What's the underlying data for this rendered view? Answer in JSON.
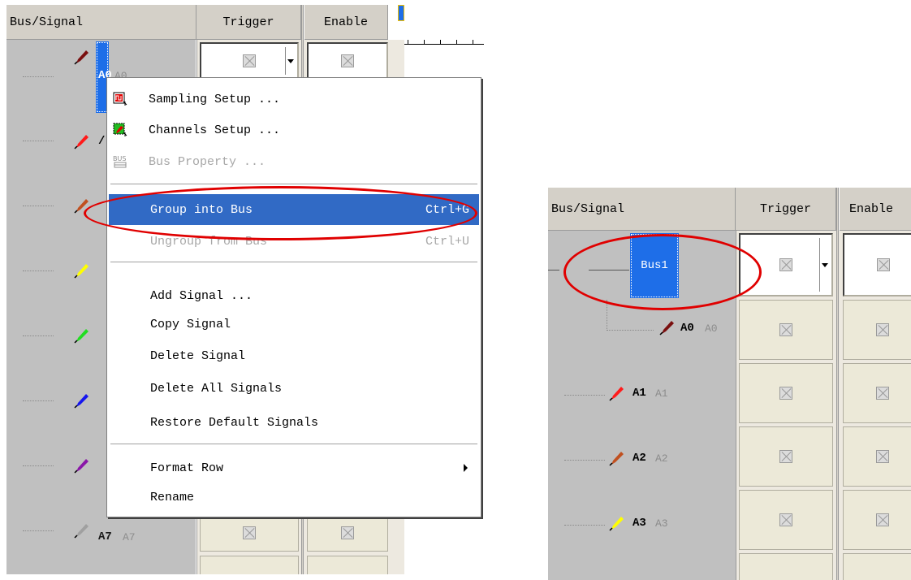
{
  "left_panel": {
    "header": {
      "signal_col": "Bus/Signal",
      "trigger_col": "Trigger",
      "enable_col": "Enable"
    },
    "selected_signal": {
      "label": "A0",
      "alias": "A0"
    },
    "last_signal": {
      "label": "A7",
      "alias": "A7",
      "color": "#a0a0a0"
    },
    "probe_colors": [
      "#7a0f0f",
      "#ff1a1a",
      "#c05020",
      "#ffff00",
      "#22dd22",
      "#1616ee",
      "#8a17a8",
      "#a0a0a0"
    ]
  },
  "context_menu": {
    "items": [
      {
        "label": "Sampling Setup ...",
        "icon": "sampling-setup-icon"
      },
      {
        "label": "Channels Setup ...",
        "icon": "channels-setup-icon"
      },
      {
        "label": "Bus Property ...",
        "icon": "bus-property-icon",
        "disabled": true
      },
      {
        "label": "Group into Bus",
        "shortcut": "Ctrl+G",
        "highlighted": true
      },
      {
        "label": "Ungroup from Bus",
        "shortcut": "Ctrl+U",
        "disabled": true
      },
      {
        "label": "Add Signal ..."
      },
      {
        "label": "Copy Signal"
      },
      {
        "label": "Delete Signal"
      },
      {
        "label": "Delete All Signals"
      },
      {
        "label": "Restore Default Signals"
      },
      {
        "label": "Format Row",
        "submenu": true
      },
      {
        "label": "Rename"
      }
    ]
  },
  "right_panel": {
    "header": {
      "signal_col": "Bus/Signal",
      "trigger_col": "Trigger",
      "enable_col": "Enable"
    },
    "bus": {
      "label": "Bus1"
    },
    "signals": [
      {
        "label": "A0",
        "alias": "A0",
        "color": "#7a0f0f"
      },
      {
        "label": "A1",
        "alias": "A1",
        "color": "#ff1a1a"
      },
      {
        "label": "A2",
        "alias": "A2",
        "color": "#c05020"
      },
      {
        "label": "A3",
        "alias": "A3",
        "color": "#ffff00"
      }
    ]
  },
  "annotation_color": "#e00000",
  "highlight_color": "#316ac5"
}
